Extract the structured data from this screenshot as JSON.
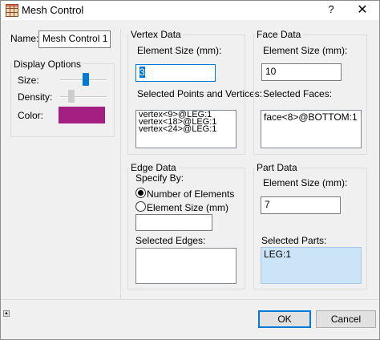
{
  "title": "Mesh Control",
  "help_glyph": "?",
  "close_glyph": "✕",
  "name": {
    "label": "Name:",
    "value": "Mesh Control 1"
  },
  "display": {
    "title": "Display Options",
    "size_label": "Size:",
    "size_level": 0.55,
    "density_label": "Density:",
    "density_level": 0.2,
    "color_label": "Color:",
    "color": "#a51e82"
  },
  "vertex": {
    "title": "Vertex Data",
    "size_label": "Element Size (mm):",
    "size_value": "3",
    "selected_label": "Selected Points and Vertices:",
    "items": [
      "vertex<9>@LEG:1",
      "vertex<18>@LEG:1",
      "vertex<24>@LEG:1"
    ]
  },
  "face": {
    "title": "Face Data",
    "size_label": "Element Size (mm):",
    "size_value": "10",
    "selected_label": "Selected Faces:",
    "items": [
      "face<8>@BOTTOM:1"
    ]
  },
  "edge": {
    "title": "Edge Data",
    "specify_label": "Specify By:",
    "option1": "Number of Elements",
    "option2": "Element Size (mm)",
    "value": "",
    "selected_label": "Selected Edges:"
  },
  "part": {
    "title": "Part Data",
    "size_label": "Element Size (mm):",
    "size_value": "7",
    "selected_label": "Selected Parts:",
    "items": [
      "LEG:1"
    ]
  },
  "buttons": {
    "ok": "OK",
    "cancel": "Cancel"
  },
  "accent": "#0078d7"
}
